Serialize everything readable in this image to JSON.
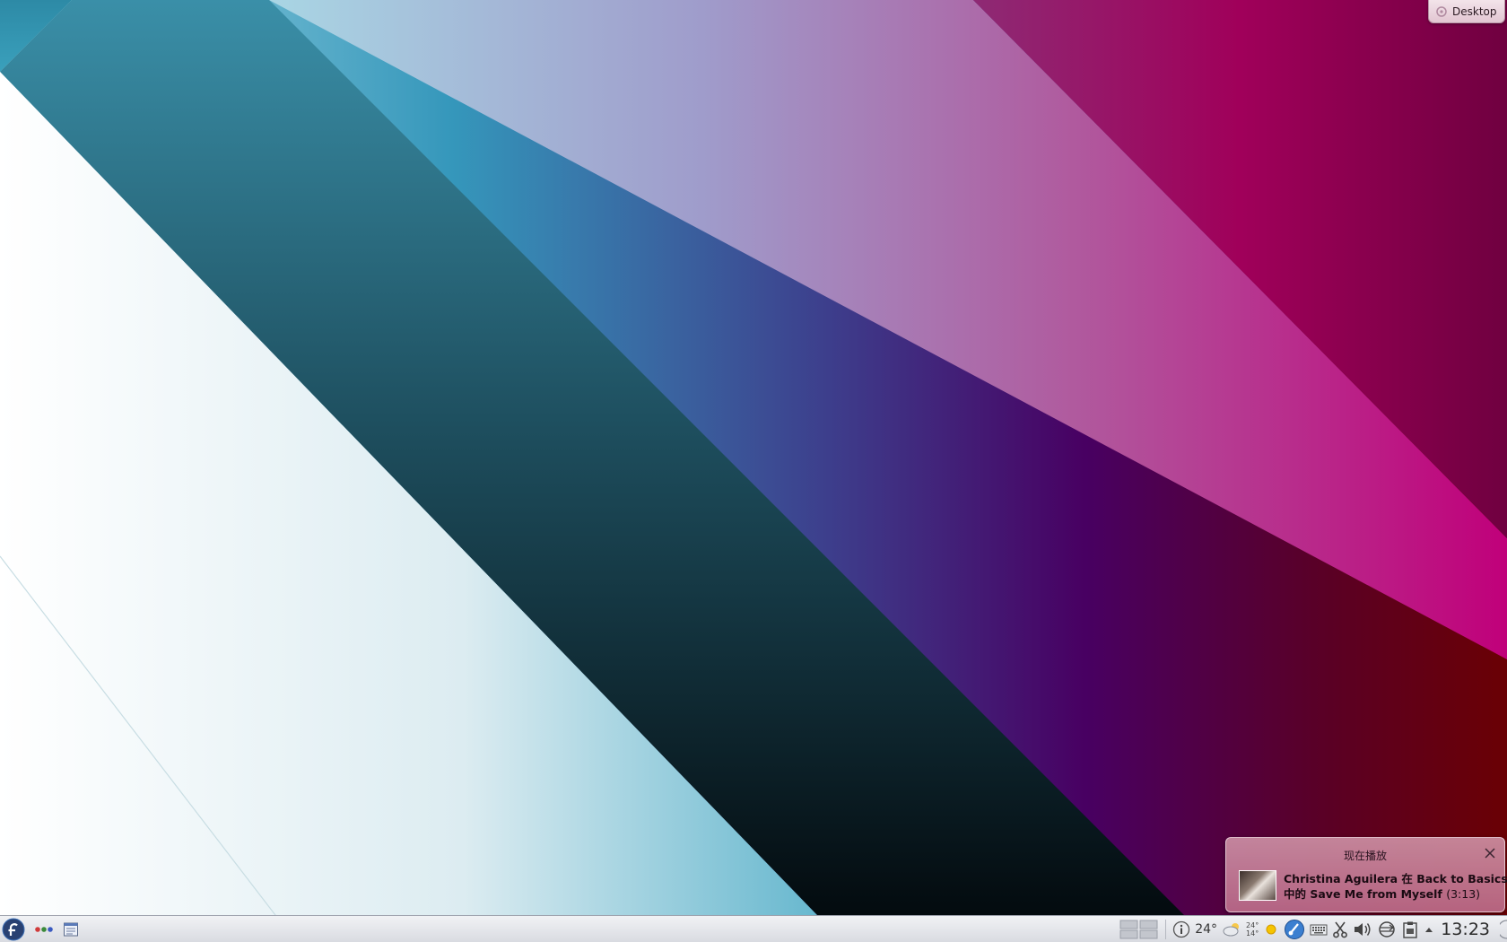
{
  "toolbox": {
    "label": "Desktop"
  },
  "notification": {
    "title": "现在播放",
    "line1": "Christina Aguilera 在 Back to Basics",
    "line2": "中的 Save Me from Myself",
    "duration": "(3:13)"
  },
  "panel": {
    "launcher_icon": "fedora-icon",
    "activities_icon": "dots-icon",
    "taskbar_icon": "window-list-icon",
    "weather": {
      "temperature": "24°",
      "high": "24°",
      "low": "14°"
    },
    "clock": "13:23"
  },
  "colors": {
    "panel_bg": "#e4e6ea",
    "notification_bg": "#c8819e",
    "accent_blue": "#3a9ab6",
    "accent_magenta": "#a0006a",
    "accent_red": "#6b0008"
  }
}
